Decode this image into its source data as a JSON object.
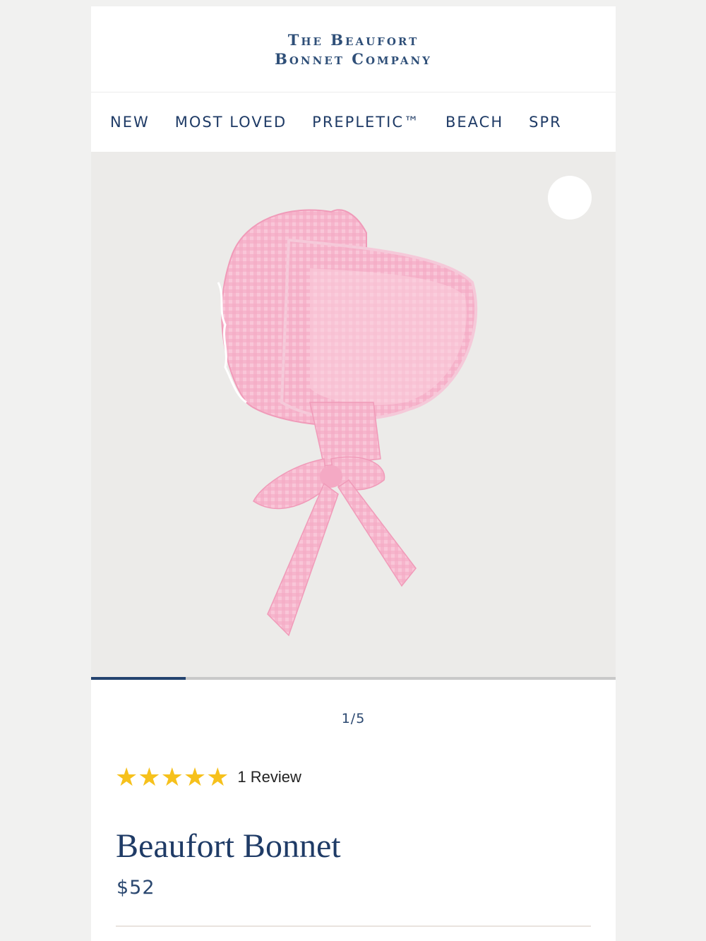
{
  "brand": {
    "line1": "The Beaufort",
    "line2": "Bonnet Company"
  },
  "nav": [
    "NEW",
    "MOST LOVED",
    "PREPLETIC™",
    "BEACH",
    "SPR"
  ],
  "gallery": {
    "counter": "1/5",
    "progress": 0.18
  },
  "rating": {
    "stars": 5,
    "review_text": "1 Review"
  },
  "product": {
    "title": "Beaufort Bonnet",
    "price": "$52"
  },
  "colors": {
    "navy": "#1f3b66",
    "star": "#f6c11c",
    "bonnet_pink": "#f7b8cf"
  }
}
